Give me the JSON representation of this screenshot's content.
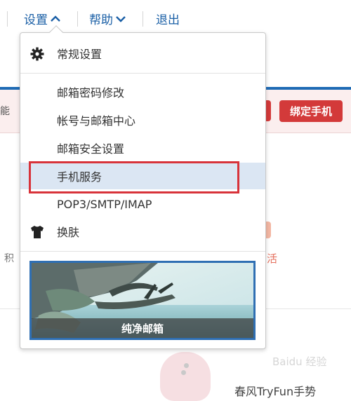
{
  "nav": {
    "settings": "设置",
    "help": "帮助",
    "logout": "退出"
  },
  "background": {
    "notice_fragment": "能",
    "bind_phone_button": "绑定手机",
    "left_fragment": "积",
    "right_fragment": "活",
    "bottom_fragment": "春风TryFun手势"
  },
  "menu": {
    "general_settings": "常规设置",
    "items": [
      {
        "label": "邮箱密码修改"
      },
      {
        "label": "帐号与邮箱中心"
      },
      {
        "label": "邮箱安全设置"
      },
      {
        "label": "手机服务"
      },
      {
        "label": "POP3/SMTP/IMAP"
      }
    ],
    "skin": "换肤",
    "skin_card_label": "纯净邮箱",
    "highlighted_item": "手机服务"
  },
  "colors": {
    "link_blue": "#1a5fa6",
    "highlight_red": "#d8333a",
    "selected_bg": "#dbe6f3",
    "button_red": "#d33a3a"
  },
  "icons": {
    "settings_caret": "chevron-up-icon",
    "help_caret": "chevron-down-icon",
    "general_settings": "gear-icon",
    "skin": "tshirt-icon"
  },
  "watermark": "Baidu 经验"
}
